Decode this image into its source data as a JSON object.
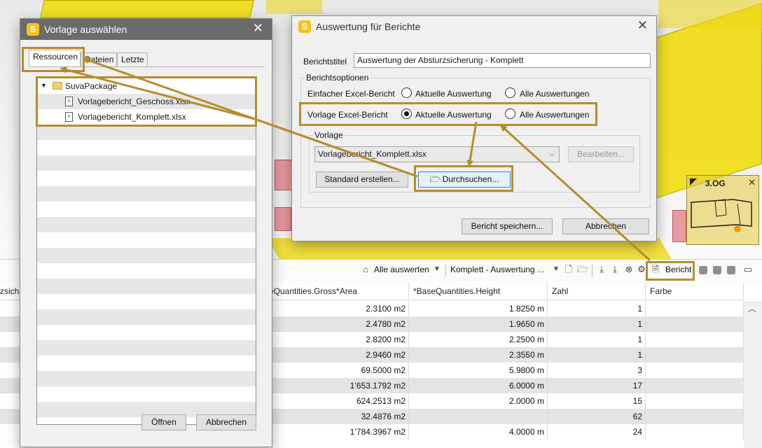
{
  "colors": {
    "highlight": "#b48e2c",
    "accent_yellow": "#f6c31a",
    "viewport_yellow": "#f0dc00"
  },
  "minimap": {
    "label": "3.OG",
    "close_icon": "close-icon"
  },
  "toolbar": {
    "filter_label": "Alle auswerten",
    "evaluation_label": "Komplett - Auswertung ...",
    "report_label": "Bericht"
  },
  "table": {
    "columns": [
      "zsiche",
      "eQuantities.Gross*Area",
      "*BaseQuantities.Height",
      "Zahl",
      "Farbe"
    ],
    "rows": [
      {
        "area": "2.3100 m2",
        "height": "1.8250 m",
        "count": "1"
      },
      {
        "area": "2.4780 m2",
        "height": "1.9650 m",
        "count": "1"
      },
      {
        "area": "2.8200 m2",
        "height": "2.2500 m",
        "count": "1"
      },
      {
        "area": "2.9460 m2",
        "height": "2.3550 m",
        "count": "1"
      },
      {
        "area": "69.5000 m2",
        "height": "5.9800 m",
        "count": "3"
      },
      {
        "area": "1’653.1792 m2",
        "height": "6.0000 m",
        "count": "17"
      },
      {
        "area": "624.2513 m2",
        "height": "2.0000 m",
        "count": "15"
      },
      {
        "area": "32.4876 m2",
        "height": "",
        "count": "62"
      },
      {
        "area": "1’784.3967 m2",
        "height": "4.0000 m",
        "count": "24"
      }
    ]
  },
  "template_dialog": {
    "title": "Vorlage auswählen",
    "app_icon_letter": "S",
    "tabs": [
      "Ressourcen",
      "Dateien",
      "Letzte"
    ],
    "tree": {
      "folder": "SuvaPackage",
      "files": [
        "Vorlagebericht_Geschoss.xlsx",
        "Vorlagebericht_Komplett.xlsx"
      ]
    },
    "open_button": "Öffnen",
    "cancel_button": "Abbrechen"
  },
  "report_dialog": {
    "title": "Auswertung für Berichte",
    "app_icon_letter": "S",
    "report_title_label": "Berichtstitel",
    "report_title_value": "Auswertung der Absturzsicherung - Komplett",
    "options_group": "Berichtsoptionen",
    "simple_excel_label": "Einfacher Excel-Bericht",
    "template_excel_label": "Vorlage Excel-Bericht",
    "radio_current": "Aktuelle Auswertung",
    "radio_all": "Alle Auswertungen",
    "simple_selected": "none",
    "template_selected": "current",
    "template_group": "Vorlage",
    "template_value": "Vorlagebericht_Komplett.xlsx",
    "edit_button": "Bearbeiten...",
    "create_default_button": "Standard erstellen...",
    "browse_button": "Durchsuchen...",
    "save_button": "Bericht speichern...",
    "cancel_button": "Abbrechen"
  }
}
